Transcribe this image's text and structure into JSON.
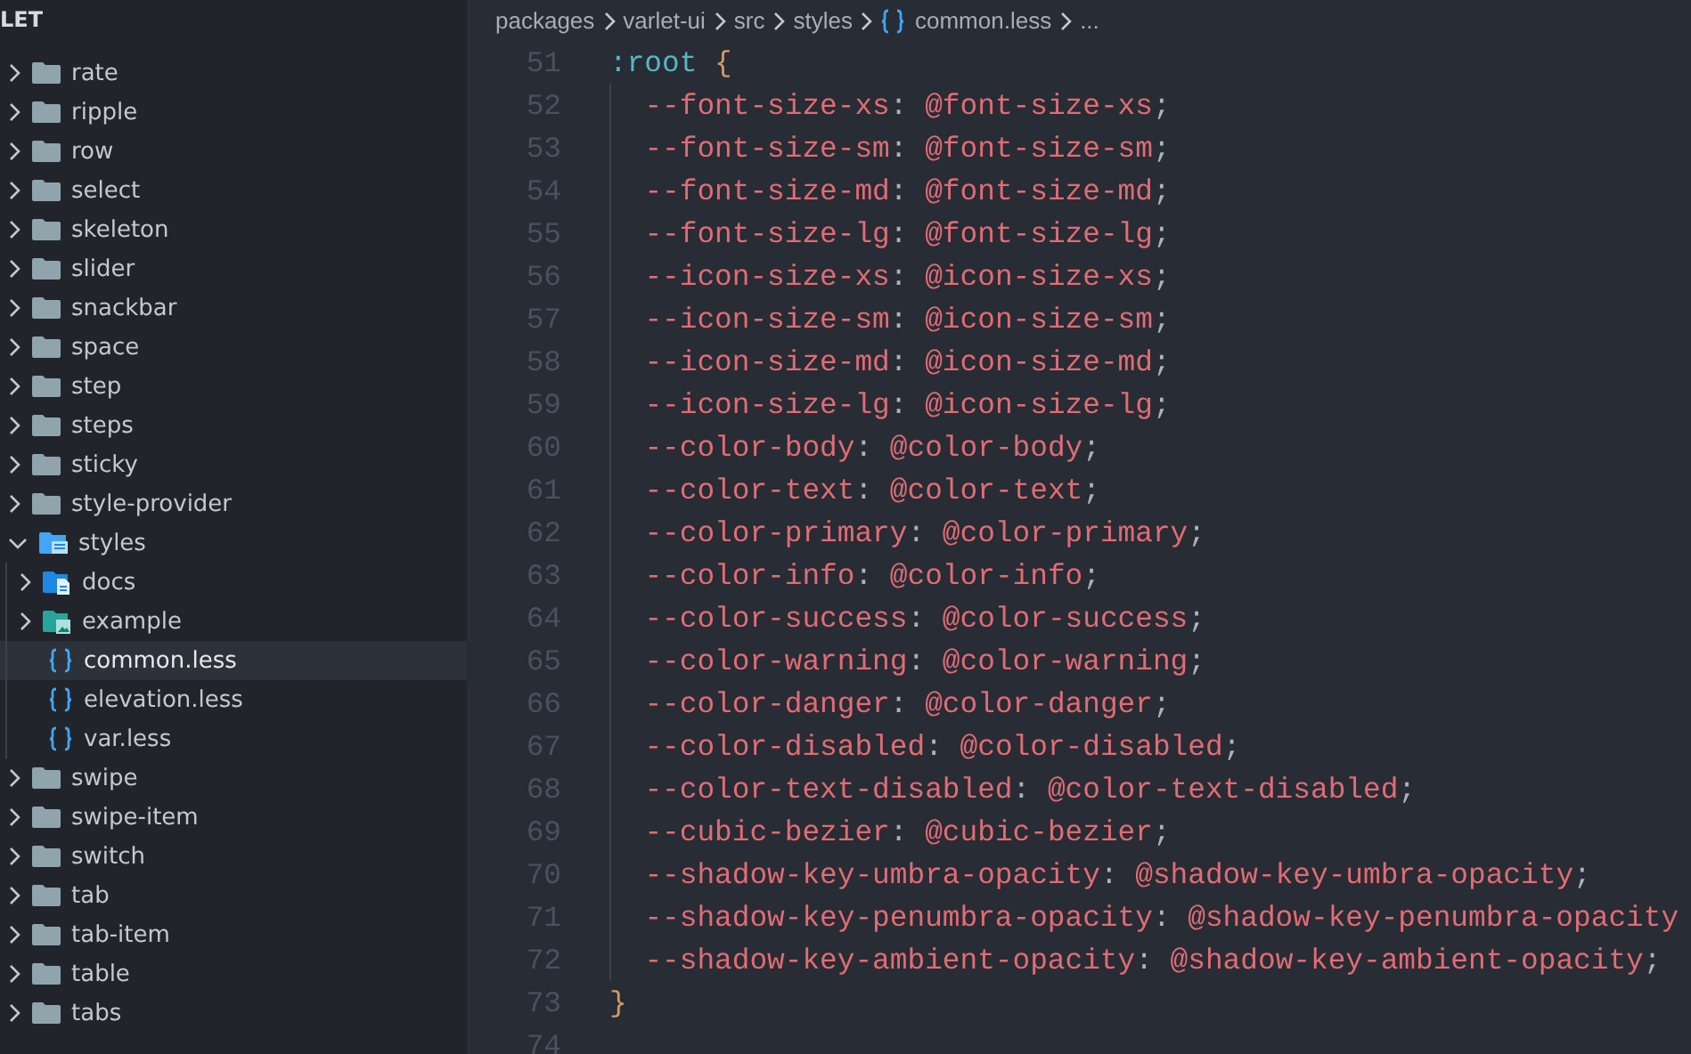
{
  "sidebar": {
    "title": "LET",
    "items": [
      {
        "label": "rate",
        "kind": "folder",
        "expanded": false,
        "selected": false
      },
      {
        "label": "ripple",
        "kind": "folder",
        "expanded": false,
        "selected": false
      },
      {
        "label": "row",
        "kind": "folder",
        "expanded": false,
        "selected": false
      },
      {
        "label": "select",
        "kind": "folder",
        "expanded": false,
        "selected": false
      },
      {
        "label": "skeleton",
        "kind": "folder",
        "expanded": false,
        "selected": false
      },
      {
        "label": "slider",
        "kind": "folder",
        "expanded": false,
        "selected": false
      },
      {
        "label": "snackbar",
        "kind": "folder",
        "expanded": false,
        "selected": false
      },
      {
        "label": "space",
        "kind": "folder",
        "expanded": false,
        "selected": false
      },
      {
        "label": "step",
        "kind": "folder",
        "expanded": false,
        "selected": false
      },
      {
        "label": "steps",
        "kind": "folder",
        "expanded": false,
        "selected": false
      },
      {
        "label": "sticky",
        "kind": "folder",
        "expanded": false,
        "selected": false
      },
      {
        "label": "style-provider",
        "kind": "folder",
        "expanded": false,
        "selected": false
      },
      {
        "label": "styles",
        "kind": "styles-folder",
        "expanded": true,
        "selected": false,
        "children": [
          {
            "label": "docs",
            "kind": "docs-folder",
            "expanded": false,
            "selected": false
          },
          {
            "label": "example",
            "kind": "picture-folder",
            "expanded": false,
            "selected": false
          },
          {
            "label": "common.less",
            "kind": "less-file",
            "selected": true
          },
          {
            "label": "elevation.less",
            "kind": "less-file",
            "selected": false
          },
          {
            "label": "var.less",
            "kind": "less-file",
            "selected": false
          }
        ]
      },
      {
        "label": "swipe",
        "kind": "folder",
        "expanded": false,
        "selected": false
      },
      {
        "label": "swipe-item",
        "kind": "folder",
        "expanded": false,
        "selected": false
      },
      {
        "label": "switch",
        "kind": "folder",
        "expanded": false,
        "selected": false
      },
      {
        "label": "tab",
        "kind": "folder",
        "expanded": false,
        "selected": false
      },
      {
        "label": "tab-item",
        "kind": "folder",
        "expanded": false,
        "selected": false
      },
      {
        "label": "table",
        "kind": "folder",
        "expanded": false,
        "selected": false
      },
      {
        "label": "tabs",
        "kind": "folder",
        "expanded": false,
        "selected": false
      }
    ]
  },
  "breadcrumb": [
    {
      "label": "packages",
      "kind": "folder"
    },
    {
      "label": "varlet-ui",
      "kind": "folder"
    },
    {
      "label": "src",
      "kind": "folder"
    },
    {
      "label": "styles",
      "kind": "folder"
    },
    {
      "label": "common.less",
      "kind": "less-file"
    },
    {
      "label": "...",
      "kind": "more"
    }
  ],
  "code": [
    {
      "number": "51",
      "indented": false,
      "tokens": [
        {
          "kind": "selector",
          "text": ":root"
        },
        {
          "kind": "brace",
          "text": "{"
        }
      ]
    },
    {
      "number": "52",
      "indented": true,
      "tokens": [
        {
          "kind": "property",
          "text": "--font-size-xs"
        },
        {
          "kind": "plain",
          "text": ": "
        },
        {
          "kind": "property",
          "text": "@font-size-xs"
        },
        {
          "kind": "plain",
          "text": ";"
        }
      ]
    },
    {
      "number": "53",
      "indented": true,
      "tokens": [
        {
          "kind": "property",
          "text": "--font-size-sm"
        },
        {
          "kind": "plain",
          "text": ": "
        },
        {
          "kind": "property",
          "text": "@font-size-sm"
        },
        {
          "kind": "plain",
          "text": ";"
        }
      ]
    },
    {
      "number": "54",
      "indented": true,
      "tokens": [
        {
          "kind": "property",
          "text": "--font-size-md"
        },
        {
          "kind": "plain",
          "text": ": "
        },
        {
          "kind": "property",
          "text": "@font-size-md"
        },
        {
          "kind": "plain",
          "text": ";"
        }
      ]
    },
    {
      "number": "55",
      "indented": true,
      "tokens": [
        {
          "kind": "property",
          "text": "--font-size-lg"
        },
        {
          "kind": "plain",
          "text": ": "
        },
        {
          "kind": "property",
          "text": "@font-size-lg"
        },
        {
          "kind": "plain",
          "text": ";"
        }
      ]
    },
    {
      "number": "56",
      "indented": true,
      "tokens": [
        {
          "kind": "property",
          "text": "--icon-size-xs"
        },
        {
          "kind": "plain",
          "text": ": "
        },
        {
          "kind": "property",
          "text": "@icon-size-xs"
        },
        {
          "kind": "plain",
          "text": ";"
        }
      ]
    },
    {
      "number": "57",
      "indented": true,
      "tokens": [
        {
          "kind": "property",
          "text": "--icon-size-sm"
        },
        {
          "kind": "plain",
          "text": ": "
        },
        {
          "kind": "property",
          "text": "@icon-size-sm"
        },
        {
          "kind": "plain",
          "text": ";"
        }
      ]
    },
    {
      "number": "58",
      "indented": true,
      "tokens": [
        {
          "kind": "property",
          "text": "--icon-size-md"
        },
        {
          "kind": "plain",
          "text": ": "
        },
        {
          "kind": "property",
          "text": "@icon-size-md"
        },
        {
          "kind": "plain",
          "text": ";"
        }
      ]
    },
    {
      "number": "59",
      "indented": true,
      "tokens": [
        {
          "kind": "property",
          "text": "--icon-size-lg"
        },
        {
          "kind": "plain",
          "text": ": "
        },
        {
          "kind": "property",
          "text": "@icon-size-lg"
        },
        {
          "kind": "plain",
          "text": ";"
        }
      ]
    },
    {
      "number": "60",
      "indented": true,
      "tokens": [
        {
          "kind": "property",
          "text": "--color-body"
        },
        {
          "kind": "plain",
          "text": ": "
        },
        {
          "kind": "property",
          "text": "@color-body"
        },
        {
          "kind": "plain",
          "text": ";"
        }
      ]
    },
    {
      "number": "61",
      "indented": true,
      "tokens": [
        {
          "kind": "property",
          "text": "--color-text"
        },
        {
          "kind": "plain",
          "text": ": "
        },
        {
          "kind": "property",
          "text": "@color-text"
        },
        {
          "kind": "plain",
          "text": ";"
        }
      ]
    },
    {
      "number": "62",
      "indented": true,
      "tokens": [
        {
          "kind": "property",
          "text": "--color-primary"
        },
        {
          "kind": "plain",
          "text": ": "
        },
        {
          "kind": "property",
          "text": "@color-primary"
        },
        {
          "kind": "plain",
          "text": ";"
        }
      ]
    },
    {
      "number": "63",
      "indented": true,
      "tokens": [
        {
          "kind": "property",
          "text": "--color-info"
        },
        {
          "kind": "plain",
          "text": ": "
        },
        {
          "kind": "property",
          "text": "@color-info"
        },
        {
          "kind": "plain",
          "text": ";"
        }
      ]
    },
    {
      "number": "64",
      "indented": true,
      "tokens": [
        {
          "kind": "property",
          "text": "--color-success"
        },
        {
          "kind": "plain",
          "text": ": "
        },
        {
          "kind": "property",
          "text": "@color-success"
        },
        {
          "kind": "plain",
          "text": ";"
        }
      ]
    },
    {
      "number": "65",
      "indented": true,
      "tokens": [
        {
          "kind": "property",
          "text": "--color-warning"
        },
        {
          "kind": "plain",
          "text": ": "
        },
        {
          "kind": "property",
          "text": "@color-warning"
        },
        {
          "kind": "plain",
          "text": ";"
        }
      ]
    },
    {
      "number": "66",
      "indented": true,
      "tokens": [
        {
          "kind": "property",
          "text": "--color-danger"
        },
        {
          "kind": "plain",
          "text": ": "
        },
        {
          "kind": "property",
          "text": "@color-danger"
        },
        {
          "kind": "plain",
          "text": ";"
        }
      ]
    },
    {
      "number": "67",
      "indented": true,
      "tokens": [
        {
          "kind": "property",
          "text": "--color-disabled"
        },
        {
          "kind": "plain",
          "text": ": "
        },
        {
          "kind": "property",
          "text": "@color-disabled"
        },
        {
          "kind": "plain",
          "text": ";"
        }
      ]
    },
    {
      "number": "68",
      "indented": true,
      "tokens": [
        {
          "kind": "property",
          "text": "--color-text-disabled"
        },
        {
          "kind": "plain",
          "text": ": "
        },
        {
          "kind": "property",
          "text": "@color-text-disabled"
        },
        {
          "kind": "plain",
          "text": ";"
        }
      ]
    },
    {
      "number": "69",
      "indented": true,
      "tokens": [
        {
          "kind": "property",
          "text": "--cubic-bezier"
        },
        {
          "kind": "plain",
          "text": ": "
        },
        {
          "kind": "property",
          "text": "@cubic-bezier"
        },
        {
          "kind": "plain",
          "text": ";"
        }
      ]
    },
    {
      "number": "70",
      "indented": true,
      "tokens": [
        {
          "kind": "property",
          "text": "--shadow-key-umbra-opacity"
        },
        {
          "kind": "plain",
          "text": ": "
        },
        {
          "kind": "property",
          "text": "@shadow-key-umbra-opacity"
        },
        {
          "kind": "plain",
          "text": ";"
        }
      ]
    },
    {
      "number": "71",
      "indented": true,
      "tokens": [
        {
          "kind": "property",
          "text": "--shadow-key-penumbra-opacity"
        },
        {
          "kind": "plain",
          "text": ": "
        },
        {
          "kind": "property",
          "text": "@shadow-key-penumbra-opacity"
        }
      ]
    },
    {
      "number": "72",
      "indented": true,
      "tokens": [
        {
          "kind": "property",
          "text": "--shadow-key-ambient-opacity"
        },
        {
          "kind": "plain",
          "text": ": "
        },
        {
          "kind": "property",
          "text": "@shadow-key-ambient-opacity"
        },
        {
          "kind": "plain",
          "text": ";"
        }
      ]
    },
    {
      "number": "73",
      "indented": false,
      "tokens": [
        {
          "kind": "brace",
          "text": "}"
        }
      ]
    },
    {
      "number": "74"
    }
  ]
}
